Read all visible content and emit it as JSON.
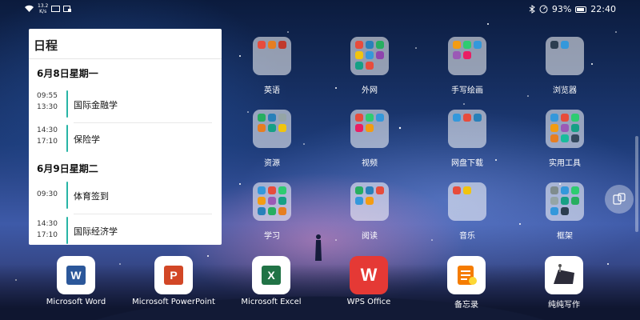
{
  "status_bar": {
    "net_speed_value": "13.2",
    "net_speed_unit": "K/s",
    "battery": "93%",
    "time": "22:40"
  },
  "schedule_widget": {
    "title": "日程",
    "days": [
      {
        "date": "6月8日星期一",
        "events": [
          {
            "start": "09:55",
            "end": "13:30",
            "name": "国际金融学"
          },
          {
            "start": "14:30",
            "end": "17:10",
            "name": "保险学"
          }
        ]
      },
      {
        "date": "6月9日星期二",
        "events": [
          {
            "start": "09:30",
            "end": "",
            "name": "体育签到"
          },
          {
            "start": "14:30",
            "end": "17:10",
            "name": "国际经济学"
          }
        ]
      }
    ]
  },
  "folders": [
    {
      "label": "英语",
      "apps": [
        "#e74c3c",
        "#e67e22",
        "#c0392b"
      ]
    },
    {
      "label": "外网",
      "apps": [
        "#e74c3c",
        "#2980b9",
        "#27ae60",
        "#f1c40f",
        "#3498db",
        "#8e44ad",
        "#16a085",
        "#e74c3c"
      ]
    },
    {
      "label": "手写绘画",
      "apps": [
        "#f39c12",
        "#2ecc71",
        "#3498db",
        "#9b59b6",
        "#e91e63"
      ]
    },
    {
      "label": "浏览器",
      "apps": [
        "#2c3e50",
        "#3498db"
      ]
    },
    {
      "label": "资源",
      "apps": [
        "#27ae60",
        "#2980b9",
        "#95a5a6",
        "#e67e22",
        "#16a085",
        "#f1c40f"
      ]
    },
    {
      "label": "视频",
      "apps": [
        "#e74c3c",
        "#2ecc71",
        "#3498db",
        "#e91e63",
        "#f39c12"
      ]
    },
    {
      "label": "网盘下载",
      "apps": [
        "#3498db",
        "#e74c3c",
        "#2980b9"
      ]
    },
    {
      "label": "实用工具",
      "apps": [
        "#3498db",
        "#e74c3c",
        "#2ecc71",
        "#f39c12",
        "#9b59b6",
        "#16a085",
        "#e67e22",
        "#1abc9c",
        "#34495e"
      ]
    },
    {
      "label": "学习",
      "apps": [
        "#3498db",
        "#e74c3c",
        "#2ecc71",
        "#f39c12",
        "#9b59b6",
        "#16a085",
        "#2980b9",
        "#27ae60",
        "#e67e22"
      ]
    },
    {
      "label": "阅读",
      "apps": [
        "#27ae60",
        "#2980b9",
        "#e74c3c",
        "#3498db",
        "#f39c12"
      ]
    },
    {
      "label": "音乐",
      "apps": [
        "#e74c3c",
        "#f1c40f"
      ]
    },
    {
      "label": "框架",
      "apps": [
        "#7f8c8d",
        "#3498db",
        "#2ecc71",
        "#95a5a6",
        "#16a085",
        "#27ae60",
        "#3498db",
        "#2c3e50"
      ]
    }
  ],
  "dock": [
    {
      "label": "Microsoft Word",
      "icon": "word-icon",
      "letter": "W",
      "color": "#2b579a",
      "bg": "#ffffff"
    },
    {
      "label": "Microsoft PowerPoint",
      "icon": "powerpoint-icon",
      "letter": "P",
      "color": "#d24726",
      "bg": "#ffffff"
    },
    {
      "label": "Microsoft Excel",
      "icon": "excel-icon",
      "letter": "X",
      "color": "#217346",
      "bg": "#ffffff"
    },
    {
      "label": "WPS Office",
      "icon": "wps-icon",
      "letter": "W",
      "color": "#ffffff",
      "bg": "#e53935"
    },
    {
      "label": "备忘录",
      "icon": "memo-icon",
      "letter": "",
      "color": "#f57c00",
      "bg": "#ffffff"
    },
    {
      "label": "纯纯写作",
      "icon": "typewriter-icon",
      "letter": "",
      "color": "#2c2c3a",
      "bg": "#ffffff"
    }
  ],
  "colors": {
    "event_accent": "#27b5a6",
    "widget_bg": "#ffffff"
  }
}
